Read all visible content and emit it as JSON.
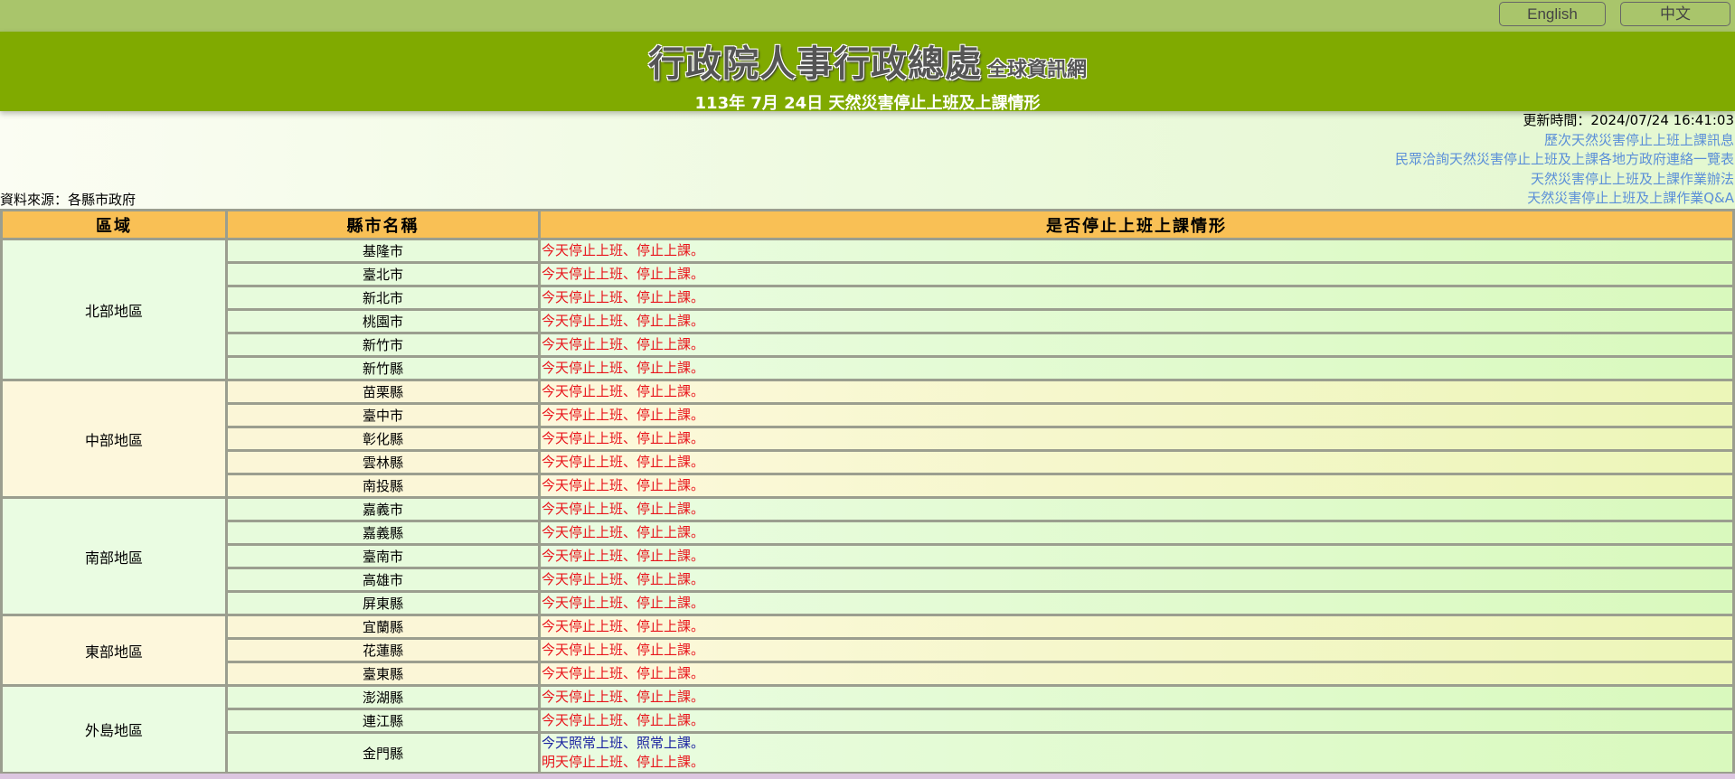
{
  "header": {
    "lang_buttons": [
      "English",
      "中文"
    ],
    "title_main": "行政院人事行政總處",
    "title_sub": "全球資訊網",
    "date_title": "113年 7月 24日 天然災害停止上班及上課情形"
  },
  "info": {
    "update_time": "更新時間：2024/07/24 16:41:03",
    "links": [
      "歷次天然災害停止上班上課訊息",
      "民眾洽詢天然災害停止上班及上課各地方政府連絡一覽表",
      "天然災害停止上班及上課作業辦法",
      "天然災害停止上班及上課作業Q&A"
    ],
    "source": "資料來源：各縣市政府"
  },
  "table": {
    "headers": [
      "區域",
      "縣市名稱",
      "是否停止上班上課情形"
    ],
    "groups": [
      {
        "region": "北部地區",
        "rows": [
          {
            "county": "基隆市",
            "status": [
              "今天停止上班、停止上課。"
            ]
          },
          {
            "county": "臺北市",
            "status": [
              "今天停止上班、停止上課。"
            ]
          },
          {
            "county": "新北市",
            "status": [
              "今天停止上班、停止上課。"
            ]
          },
          {
            "county": "桃園市",
            "status": [
              "今天停止上班、停止上課。"
            ]
          },
          {
            "county": "新竹市",
            "status": [
              "今天停止上班、停止上課。"
            ]
          },
          {
            "county": "新竹縣",
            "status": [
              "今天停止上班、停止上課。"
            ]
          }
        ]
      },
      {
        "region": "中部地區",
        "rows": [
          {
            "county": "苗栗縣",
            "status": [
              "今天停止上班、停止上課。"
            ]
          },
          {
            "county": "臺中市",
            "status": [
              "今天停止上班、停止上課。"
            ]
          },
          {
            "county": "彰化縣",
            "status": [
              "今天停止上班、停止上課。"
            ]
          },
          {
            "county": "雲林縣",
            "status": [
              "今天停止上班、停止上課。"
            ]
          },
          {
            "county": "南投縣",
            "status": [
              "今天停止上班、停止上課。"
            ]
          }
        ]
      },
      {
        "region": "南部地區",
        "rows": [
          {
            "county": "嘉義市",
            "status": [
              "今天停止上班、停止上課。"
            ]
          },
          {
            "county": "嘉義縣",
            "status": [
              "今天停止上班、停止上課。"
            ]
          },
          {
            "county": "臺南市",
            "status": [
              "今天停止上班、停止上課。"
            ]
          },
          {
            "county": "高雄市",
            "status": [
              "今天停止上班、停止上課。"
            ]
          },
          {
            "county": "屏東縣",
            "status": [
              "今天停止上班、停止上課。"
            ]
          }
        ]
      },
      {
        "region": "東部地區",
        "rows": [
          {
            "county": "宜蘭縣",
            "status": [
              "今天停止上班、停止上課。"
            ]
          },
          {
            "county": "花蓮縣",
            "status": [
              "今天停止上班、停止上課。"
            ]
          },
          {
            "county": "臺東縣",
            "status": [
              "今天停止上班、停止上課。"
            ]
          }
        ]
      },
      {
        "region": "外島地區",
        "rows": [
          {
            "county": "澎湖縣",
            "status": [
              "今天停止上班、停止上課。"
            ]
          },
          {
            "county": "連江縣",
            "status": [
              "今天停止上班、停止上課。"
            ]
          },
          {
            "county": "金門縣",
            "status": [
              "今天照常上班、照常上課。",
              "明天停止上班、停止上課。"
            ]
          }
        ]
      }
    ]
  },
  "colors": {
    "stop_text": "#e8141b",
    "normal_text": "#1a22a0",
    "banner": "#80aa00",
    "topbar": "#a9c56b",
    "header_row": "#f9c055",
    "link": "#5b8fd8"
  }
}
